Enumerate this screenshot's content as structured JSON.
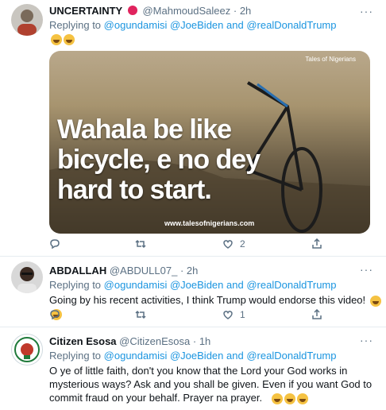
{
  "tweets": [
    {
      "name": "UNCERTAINTY",
      "handle": "@MahmoudSaleez",
      "sep": "·",
      "time": "2h",
      "reply_prefix": "Replying to",
      "mentions": [
        "@ogundamisi",
        "@JoeBiden",
        "and",
        "@realDonaldTrump"
      ],
      "media": {
        "meme_lines": [
          "Wahala be like",
          "bicycle, e no dey",
          "hard to start."
        ],
        "watermark": "www.talesofnigerians.com",
        "logo_text": "Tales of Nigerians"
      },
      "actions": {
        "reply": "",
        "retweet": "",
        "like": "2",
        "share": ""
      }
    },
    {
      "name": "ABDALLAH",
      "handle": "@ABDULL07_",
      "sep": "·",
      "time": "2h",
      "reply_prefix": "Replying to",
      "mentions": [
        "@ogundamisi",
        "@JoeBiden",
        "and",
        "@realDonaldTrump"
      ],
      "body": "Going by his recent activities, I think Trump would endorse this video!",
      "actions": {
        "reply": "",
        "retweet": "",
        "like": "1",
        "share": ""
      }
    },
    {
      "name": "Citizen Esosa",
      "handle": "@CitizenEsosa",
      "sep": "·",
      "time": "1h",
      "reply_prefix": "Replying to",
      "mentions": [
        "@ogundamisi",
        "@JoeBiden",
        "and",
        "@realDonaldTrump"
      ],
      "body_lines": [
        "O ye of little faith, don't you know that the Lord your God works in",
        "mysterious ways?  Ask and you shall be given.  Even if you want God to",
        "commit fraud on your behalf.  Prayer na prayer."
      ]
    }
  ],
  "icons": {
    "more": "more-horizontal-icon",
    "reply": "reply-icon",
    "retweet": "retweet-icon",
    "like": "like-icon",
    "share": "share-icon"
  },
  "colors": {
    "link": "#1b95e0",
    "muted": "#5b7083",
    "badge": "#e0245e"
  }
}
